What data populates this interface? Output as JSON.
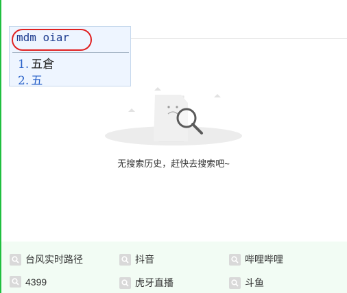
{
  "ime": {
    "input": "mdm oiar",
    "candidates": [
      {
        "num": "1.",
        "text": "五倉"
      },
      {
        "num": "2.",
        "text": "五"
      }
    ]
  },
  "empty_state": {
    "message": "无搜索历史，赶快去搜索吧~"
  },
  "hot_searches": [
    "台风实时路径",
    "抖音",
    "哔哩哔哩",
    "4399",
    "虎牙直播",
    "斗鱼"
  ],
  "colors": {
    "accent": "#1fbf3f",
    "hot_bg": "#f2fcf4",
    "ime_bg": "#eef5ff",
    "highlight_circle": "#e02020",
    "candidate_blue": "#2a62c9"
  }
}
